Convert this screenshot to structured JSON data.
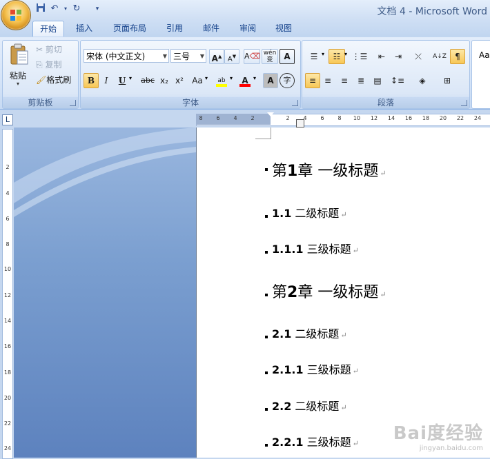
{
  "window": {
    "title": "文档 4 - Microsoft Word"
  },
  "quick_access": {
    "save_icon": "save-icon",
    "undo_icon": "undo-icon",
    "redo_icon": "redo-icon"
  },
  "tabs": [
    {
      "label": "开始",
      "active": true
    },
    {
      "label": "插入"
    },
    {
      "label": "页面布局"
    },
    {
      "label": "引用"
    },
    {
      "label": "邮件"
    },
    {
      "label": "审阅"
    },
    {
      "label": "视图"
    }
  ],
  "clipboard": {
    "paste": "粘贴",
    "cut": "剪切",
    "copy": "复制",
    "format_painter": "格式刷",
    "group": "剪贴板"
  },
  "font": {
    "name": "宋体 (中文正文)",
    "size": "三号",
    "bold": "B",
    "italic": "I",
    "underline": "U",
    "strike": "abc",
    "sub": "x₂",
    "sup": "x²",
    "case": "Aa",
    "grow": "A",
    "shrink": "A",
    "clear": "A",
    "phonetic": "wén",
    "phonetic_char": "变",
    "border": "A",
    "shade": "A",
    "enclose": "字",
    "highlight_mark": "ab",
    "group": "字体"
  },
  "paragraph": {
    "group": "段落"
  },
  "styles": {
    "preview": "Aa"
  },
  "ruler": {
    "h_numbers": [
      "8",
      "6",
      "4",
      "2",
      "2",
      "4",
      "6",
      "8",
      "10",
      "12",
      "14",
      "16",
      "18",
      "20",
      "22",
      "24"
    ],
    "v_numbers": [
      "2",
      "4",
      "6",
      "8",
      "10",
      "12",
      "14",
      "16",
      "18",
      "20",
      "22",
      "24"
    ]
  },
  "document": {
    "headings": [
      {
        "level": 1,
        "prefix": "第",
        "num": "1",
        "suffix": "章  一级标题"
      },
      {
        "level": 2,
        "num": "1.1",
        "text": " 二级标题"
      },
      {
        "level": 3,
        "num": "1.1.1",
        "text": " 三级标题"
      },
      {
        "level": 1,
        "prefix": "第",
        "num": "2",
        "suffix": "章  一级标题"
      },
      {
        "level": 2,
        "num": "2.1",
        "text": " 二级标题"
      },
      {
        "level": 3,
        "num": "2.1.1",
        "text": " 三级标题"
      },
      {
        "level": 2,
        "num": "2.2",
        "text": " 二级标题"
      },
      {
        "level": 3,
        "num": "2.2.1",
        "text": " 三级标题"
      }
    ],
    "return_mark": "↵"
  },
  "watermark": {
    "logo": "Bai度经验",
    "url": "jingyan.baidu.com"
  },
  "colors": {
    "highlight": "#ffff00",
    "font_color": "#ff0000",
    "accent": "#15428b"
  }
}
